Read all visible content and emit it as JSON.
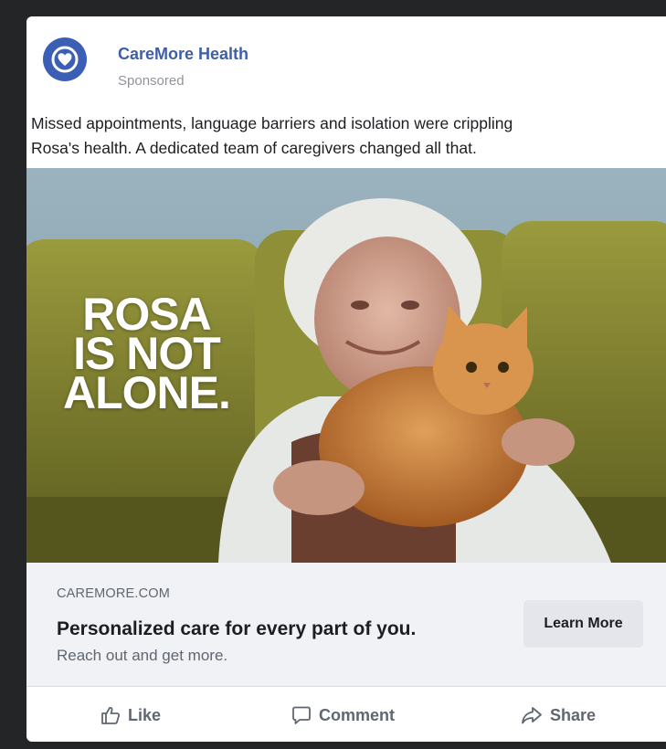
{
  "post": {
    "page_name": "CareMore Health",
    "sponsored_label": "Sponsored",
    "caption_line1": "Missed appointments, language barriers and isolation were crippling",
    "caption_line2": "Rosa's health. A dedicated team of caregivers changed all that.",
    "avatar_icon": "heart-logo-icon",
    "brand_color": "#3b5fb4"
  },
  "hero": {
    "overlay_line1": "ROSA",
    "overlay_line2": "IS NOT",
    "overlay_line3": "ALONE."
  },
  "link": {
    "domain": "CAREMORE.COM",
    "title": "Personalized care for every part of you.",
    "description": "Reach out and get more.",
    "cta_label": "Learn More"
  },
  "actions": {
    "like_label": "Like",
    "like_icon": "thumbs-up-icon",
    "comment_label": "Comment",
    "comment_icon": "comment-bubble-icon",
    "share_label": "Share",
    "share_icon": "share-arrow-icon"
  }
}
